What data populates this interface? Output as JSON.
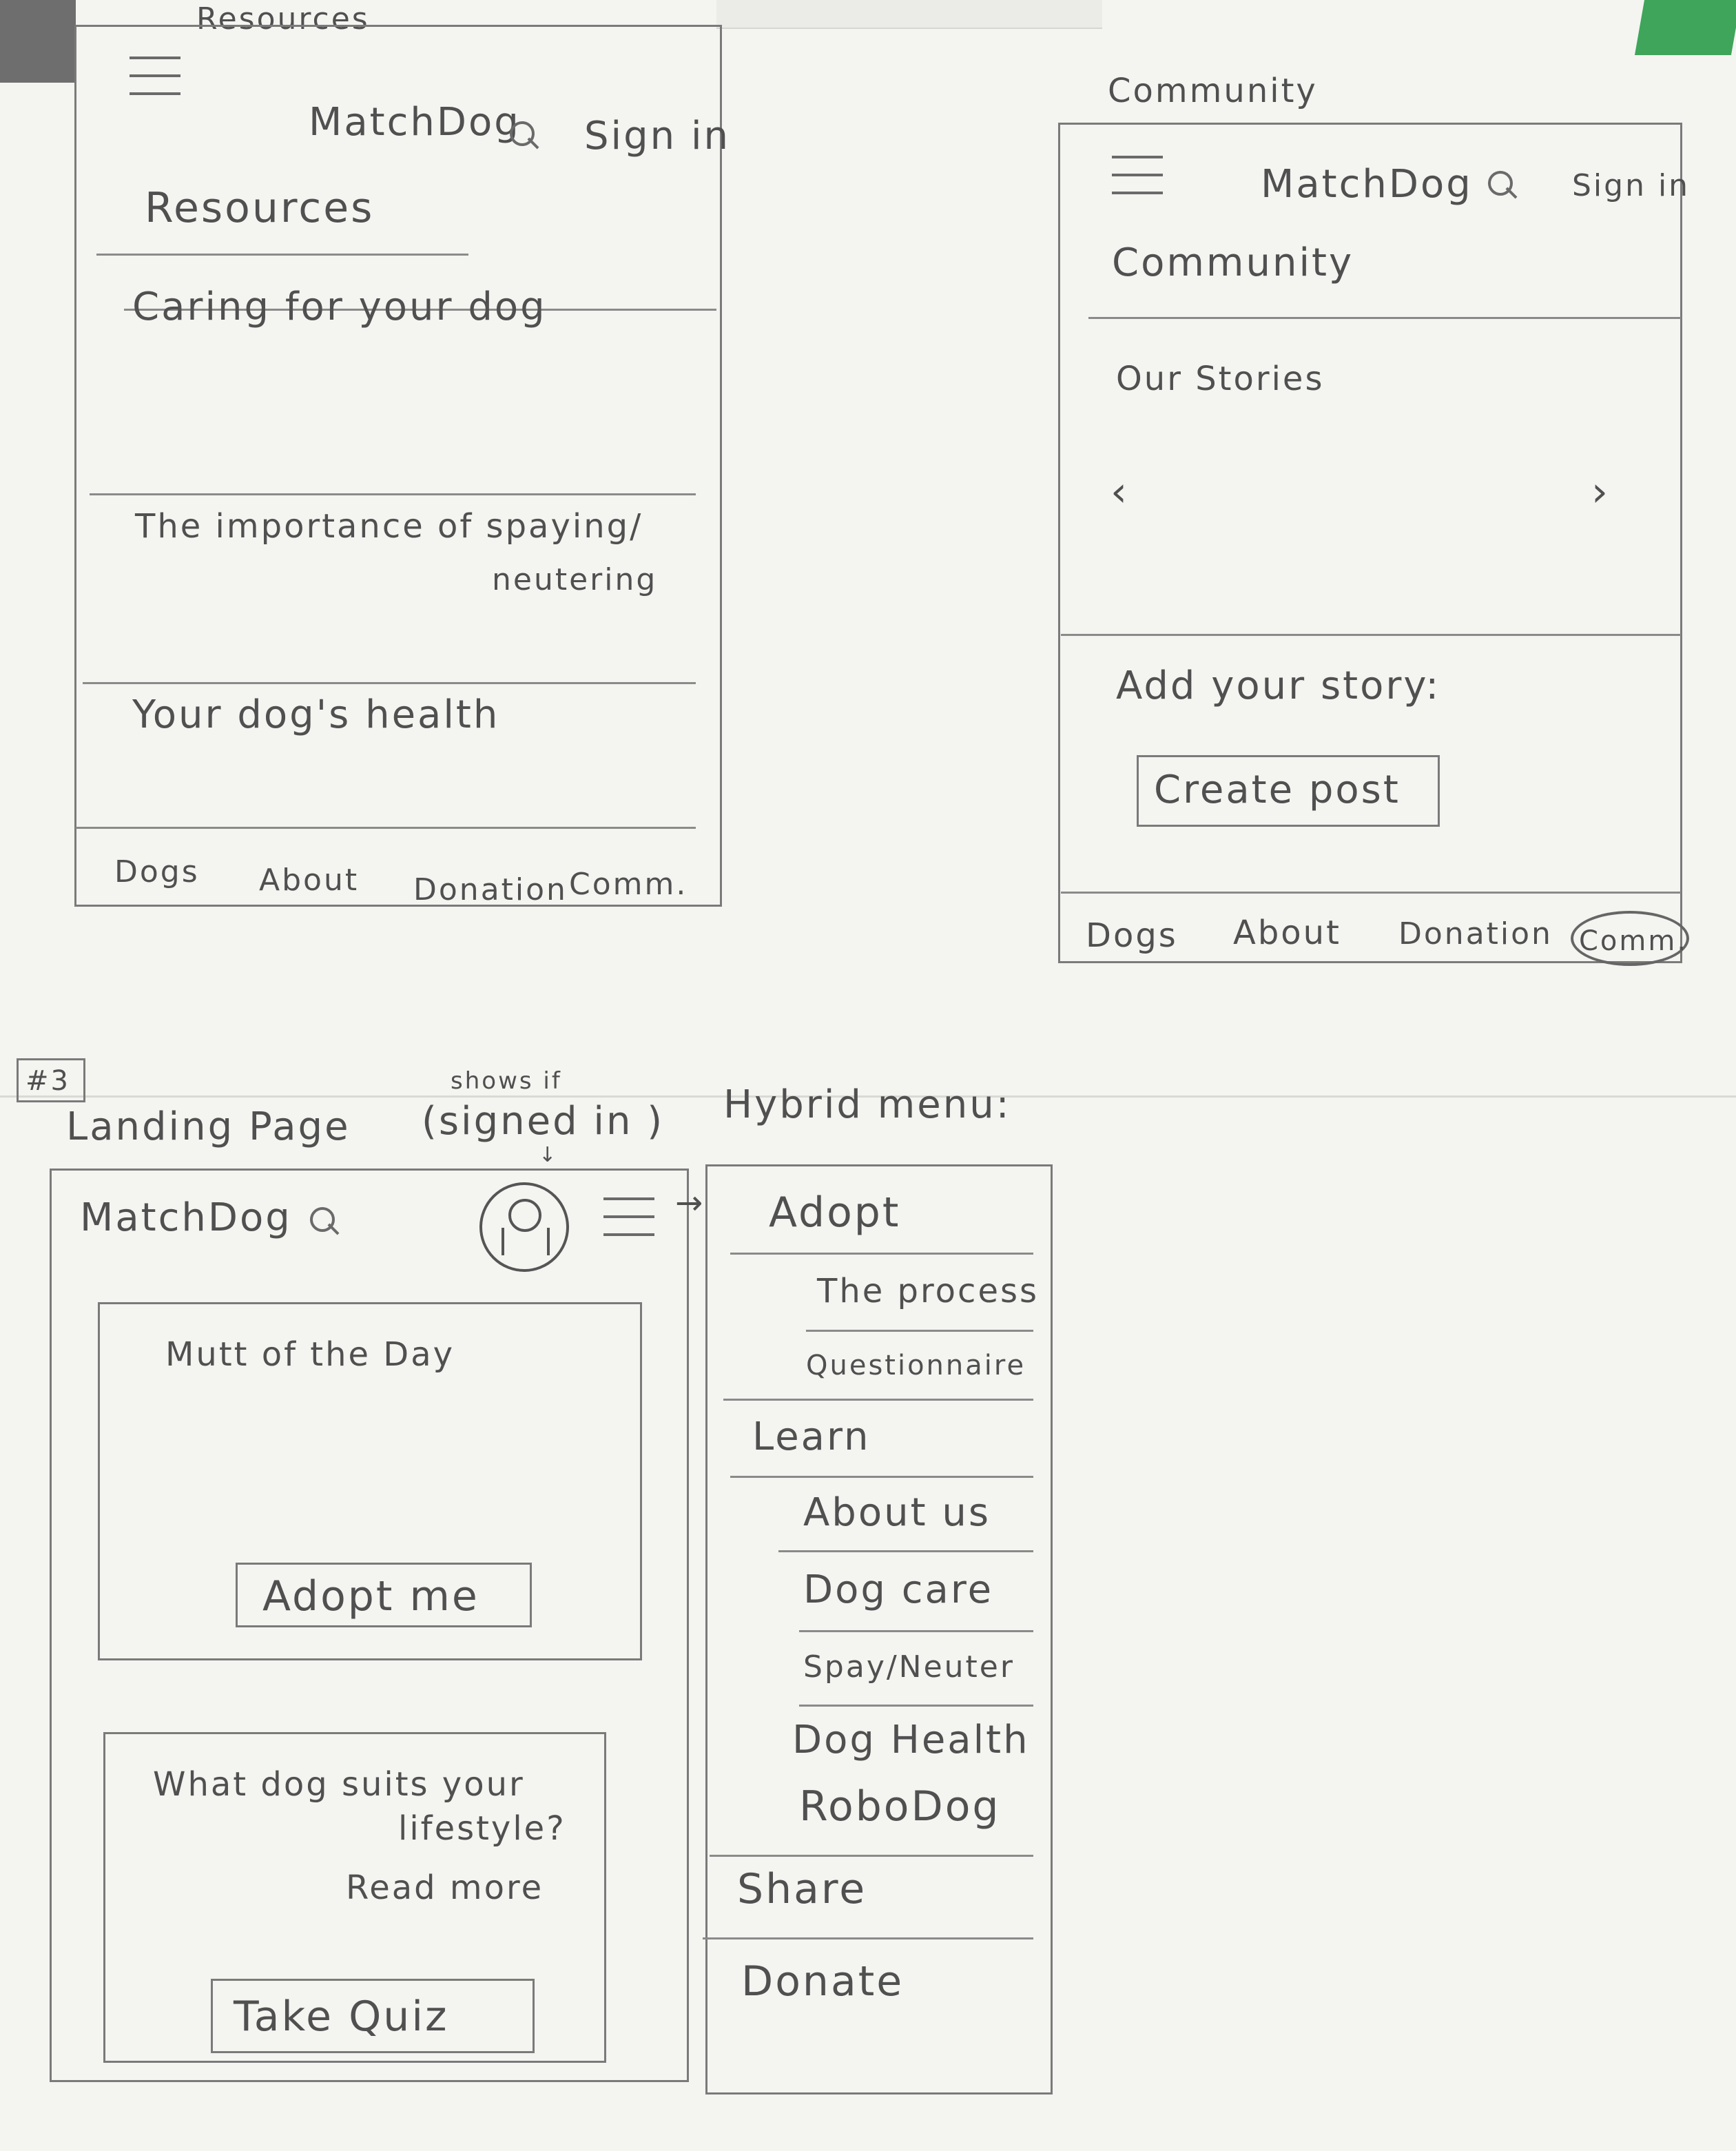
{
  "resources": {
    "caption": "Resources",
    "header": {
      "logo": "MatchDog",
      "sign_in": "Sign in"
    },
    "title": "Resources",
    "sections": [
      "Caring for your dog",
      "The importance of spaying/",
      "neutering",
      "Your dog's health"
    ],
    "nav": [
      "Dogs",
      "About",
      "Donation",
      "Comm."
    ]
  },
  "community": {
    "caption": "Community",
    "header": {
      "logo": "MatchDog",
      "sign_in": "Sign in"
    },
    "title": "Community",
    "stories": {
      "label": "Our Stories",
      "prev": "‹",
      "next": "›"
    },
    "add_story": {
      "label": "Add your story:",
      "button": "Create post"
    },
    "nav": [
      "Dogs",
      "About",
      "Donation",
      "Comm."
    ]
  },
  "landing": {
    "number": "#3",
    "caption": "Landing Page",
    "note": "shows if",
    "note2": "(signed in )",
    "header": {
      "logo": "MatchDog"
    },
    "mutt": {
      "title": "Mutt of the Day",
      "button": "Adopt me"
    },
    "quiz": {
      "line1": "What dog suits your",
      "line2": "lifestyle?",
      "read_more": "Read more",
      "button": "Take Quiz"
    }
  },
  "hybrid_menu": {
    "caption": "Hybrid menu:",
    "items": [
      {
        "label": "Adopt",
        "level": 0
      },
      {
        "label": "The process",
        "level": 1
      },
      {
        "label": "Questionnaire",
        "level": 1
      },
      {
        "label": "Learn",
        "level": 0
      },
      {
        "label": "About us",
        "level": 1
      },
      {
        "label": "Dog care",
        "level": 1
      },
      {
        "label": "Spay/Neuter",
        "level": 1
      },
      {
        "label": "Dog Health",
        "level": 1
      },
      {
        "label": "RoboDog",
        "level": 1
      },
      {
        "label": "Share",
        "level": 0
      },
      {
        "label": "Donate",
        "level": 0
      }
    ]
  }
}
